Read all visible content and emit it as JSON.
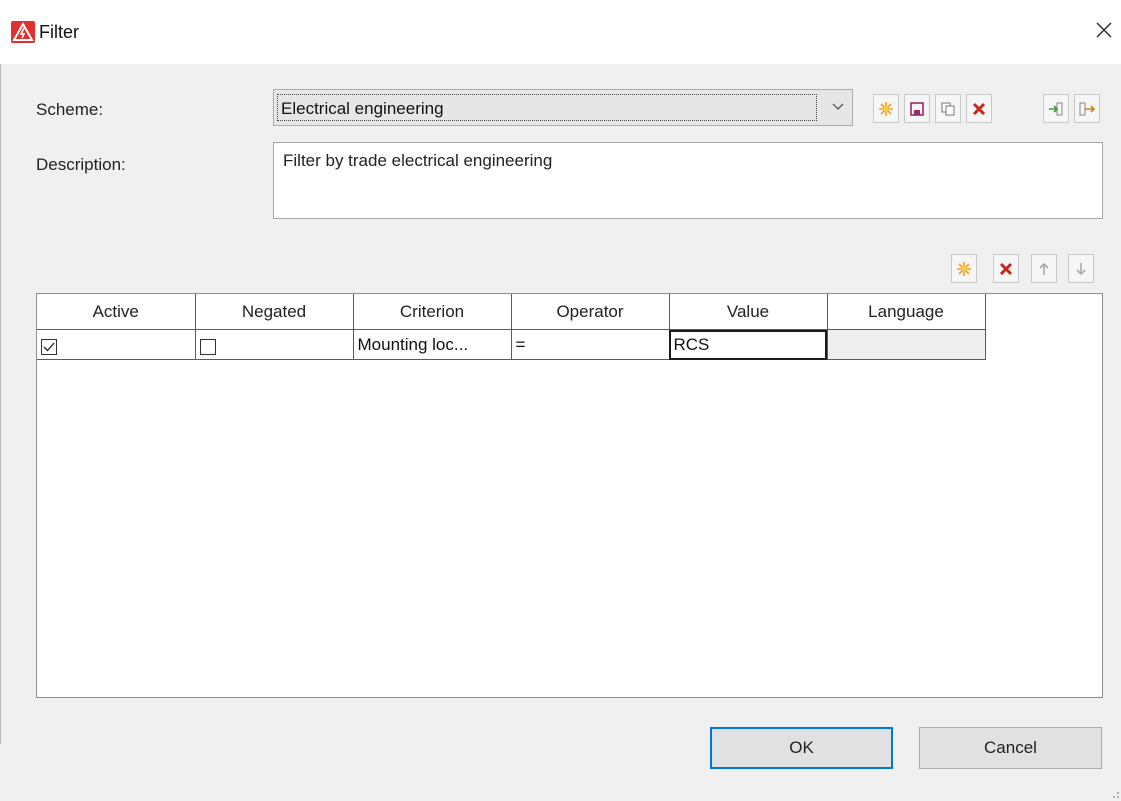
{
  "window": {
    "title": "Filter",
    "close_icon": "close-icon"
  },
  "form": {
    "scheme_label": "Scheme:",
    "scheme_value": "Electrical engineering",
    "description_label": "Description:",
    "description_value": "Filter by trade electrical engineering"
  },
  "scheme_toolbar": [
    "new-icon",
    "save-icon",
    "copy-icon",
    "delete-icon",
    "import-icon",
    "export-icon"
  ],
  "grid_toolbar": [
    "new-icon",
    "delete-icon",
    "move-up-icon",
    "move-down-icon"
  ],
  "grid": {
    "columns": [
      "Active",
      "Negated",
      "Criterion",
      "Operator",
      "Value",
      "Language"
    ],
    "rows": [
      {
        "active": true,
        "negated": false,
        "criterion": "Mounting loc...",
        "operator": "=",
        "value": "RCS",
        "language": ""
      }
    ]
  },
  "buttons": {
    "ok": "OK",
    "cancel": "Cancel"
  },
  "colors": {
    "accent": "#0078d7",
    "delete": "#c8251b",
    "new": "#f0a020",
    "save": "#9b2a6a",
    "app_icon": "#e03030"
  }
}
